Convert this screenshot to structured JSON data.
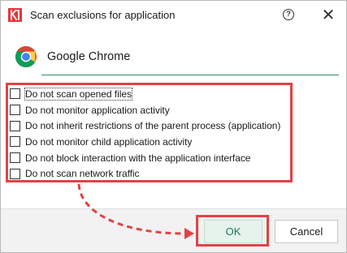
{
  "window": {
    "title": "Scan exclusions for application",
    "help_icon": "question-circle-icon",
    "close_label": "✕"
  },
  "application": {
    "name": "Google Chrome",
    "icon": "chrome-icon"
  },
  "options": [
    {
      "label": "Do not scan opened files",
      "checked": false,
      "focused": true
    },
    {
      "label": "Do not monitor application activity",
      "checked": false,
      "focused": false
    },
    {
      "label": "Do not inherit restrictions of the parent process (application)",
      "checked": false,
      "focused": false
    },
    {
      "label": "Do not monitor child application activity",
      "checked": false,
      "focused": false
    },
    {
      "label": "Do not block interaction with the application interface",
      "checked": false,
      "focused": false
    },
    {
      "label": "Do not scan network traffic",
      "checked": false,
      "focused": false
    }
  ],
  "buttons": {
    "ok": "OK",
    "cancel": "Cancel"
  },
  "colors": {
    "highlight": "#e24244",
    "accent": "#1c7a55",
    "brand": "#e8343a"
  }
}
